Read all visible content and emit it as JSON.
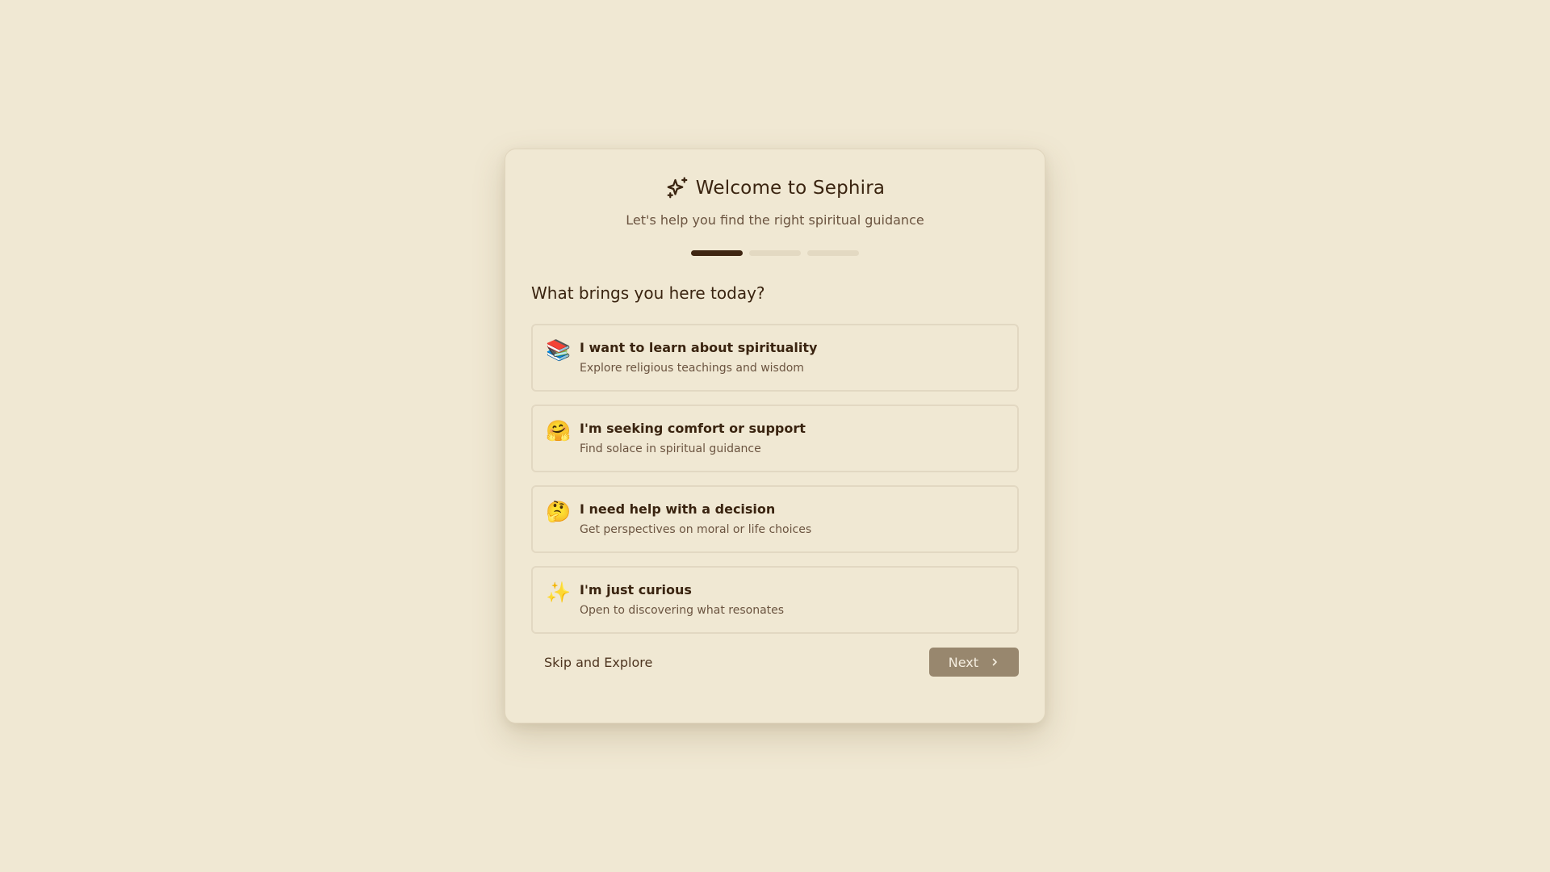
{
  "header": {
    "icon": "sparkles-icon",
    "title": "Welcome to Sephira",
    "subtitle": "Let's help you find the right spiritual guidance"
  },
  "progress": {
    "total_steps": 3,
    "current_step": 1
  },
  "question": "What brings you here today?",
  "options": [
    {
      "emoji": "📚",
      "title": "I want to learn about spirituality",
      "description": "Explore religious teachings and wisdom"
    },
    {
      "emoji": "🤗",
      "title": "I'm seeking comfort or support",
      "description": "Find solace in spiritual guidance"
    },
    {
      "emoji": "🤔",
      "title": "I need help with a decision",
      "description": "Get perspectives on moral or life choices"
    },
    {
      "emoji": "✨",
      "title": "I'm just curious",
      "description": "Open to discovering what resonates"
    }
  ],
  "footer": {
    "skip_label": "Skip and Explore",
    "next_label": "Next",
    "next_icon": "chevron-right-icon"
  },
  "colors": {
    "background": "#f0e8d3",
    "text_primary": "#3a2410",
    "text_secondary": "#6b5440",
    "progress_active": "#3f2612",
    "progress_inactive": "#e3d9c2",
    "next_button": "#98876e"
  }
}
